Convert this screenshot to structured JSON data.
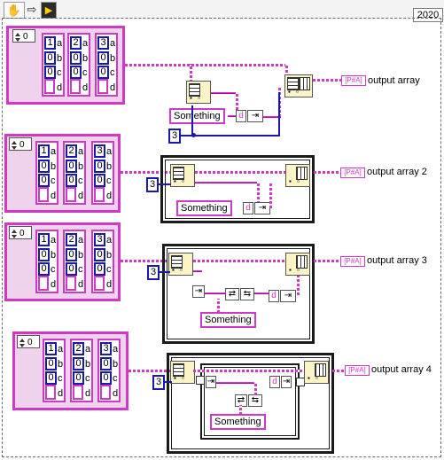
{
  "toolbar": {
    "icons": [
      "hand-icon",
      "run-arrow-icon",
      "highlight-bulb-icon"
    ],
    "version": "2020"
  },
  "controls": [
    {
      "index": "0",
      "clusters": [
        {
          "number": "1",
          "letters": [
            "a",
            "b",
            "c",
            "d"
          ],
          "values": [
            "0",
            "0"
          ]
        },
        {
          "number": "2",
          "letters": [
            "a",
            "b",
            "c",
            "d"
          ],
          "values": [
            "0",
            "0"
          ]
        },
        {
          "number": "3",
          "letters": [
            "a",
            "b",
            "c",
            "d"
          ],
          "values": [
            "0",
            "0"
          ]
        }
      ]
    },
    {
      "index": "0",
      "clusters": [
        {
          "number": "1",
          "letters": [
            "a",
            "b",
            "c",
            "d"
          ],
          "values": [
            "0",
            "0"
          ]
        },
        {
          "number": "2",
          "letters": [
            "a",
            "b",
            "c",
            "d"
          ],
          "values": [
            "0",
            "0"
          ]
        },
        {
          "number": "3",
          "letters": [
            "a",
            "b",
            "c",
            "d"
          ],
          "values": [
            "0",
            "0"
          ]
        }
      ]
    },
    {
      "index": "0",
      "clusters": [
        {
          "number": "1",
          "letters": [
            "a",
            "b",
            "c",
            "d"
          ],
          "values": [
            "0",
            "0"
          ]
        },
        {
          "number": "2",
          "letters": [
            "a",
            "b",
            "c",
            "d"
          ],
          "values": [
            "0",
            "0"
          ]
        },
        {
          "number": "3",
          "letters": [
            "a",
            "b",
            "c",
            "d"
          ],
          "values": [
            "0",
            "0"
          ]
        }
      ]
    },
    {
      "index": "0",
      "clusters": [
        {
          "number": "1",
          "letters": [
            "a",
            "b",
            "c",
            "d"
          ],
          "values": [
            "0",
            "0"
          ]
        },
        {
          "number": "2",
          "letters": [
            "a",
            "b",
            "c",
            "d"
          ],
          "values": [
            "0",
            "0"
          ]
        },
        {
          "number": "3",
          "letters": [
            "a",
            "b",
            "c",
            "d"
          ],
          "values": [
            "0",
            "0"
          ]
        }
      ]
    }
  ],
  "constants": {
    "string_value": "Something",
    "element_label": "d",
    "numeric_constant": "3"
  },
  "indicators": [
    {
      "label": "output array",
      "terminal": "[P#A]"
    },
    {
      "label": "output array 2",
      "terminal": "[P#A]"
    },
    {
      "label": "output array 3",
      "terminal": "[P#A]"
    },
    {
      "label": "output array 4",
      "terminal": "[P#A]"
    }
  ],
  "colors": {
    "cluster_wire": "#d038c6",
    "numeric_wire": "#1a1aa8",
    "structure_border": "#1a1a1a",
    "node_fill": "#fbf4c6"
  }
}
